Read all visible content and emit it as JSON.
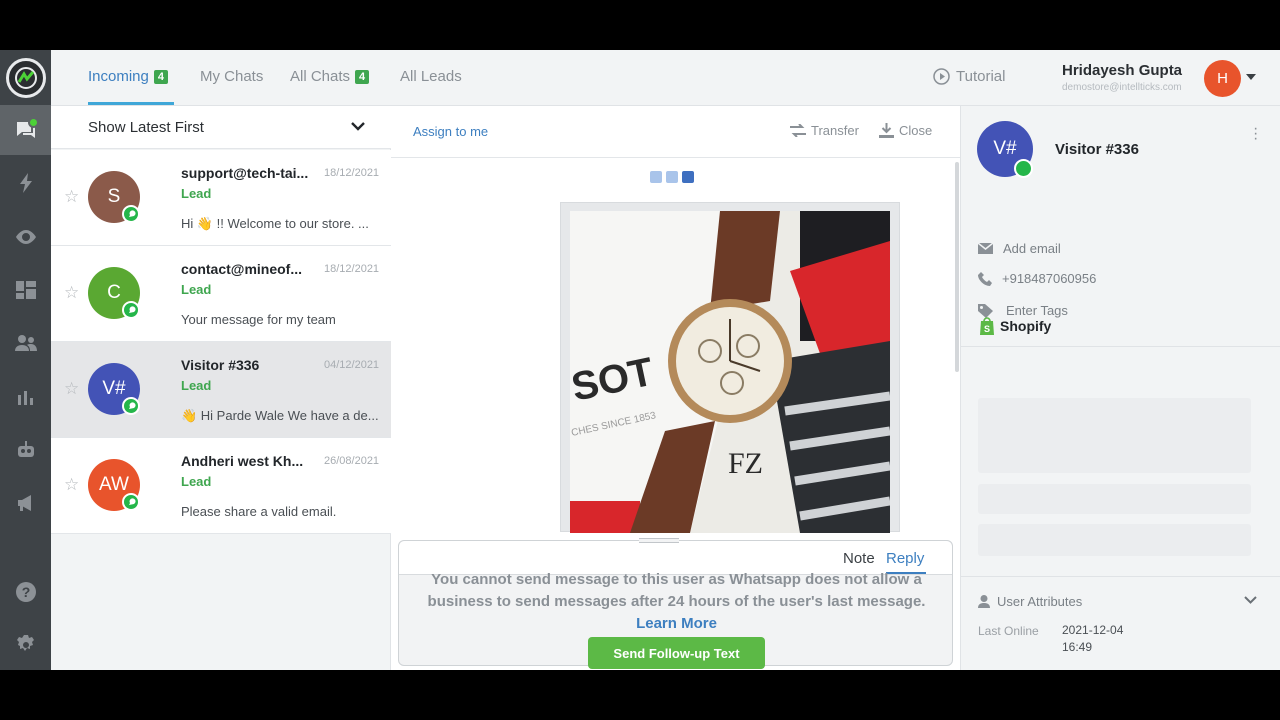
{
  "header": {
    "tabs": [
      {
        "label": "Incoming",
        "badge": "4"
      },
      {
        "label": "My Chats",
        "badge": ""
      },
      {
        "label": "All Chats",
        "badge": "4"
      },
      {
        "label": "All Leads",
        "badge": ""
      }
    ],
    "tutorial_label": "Tutorial",
    "user": {
      "name": "Hridayesh Gupta",
      "email": "demostore@intellticks.com",
      "initial": "H"
    }
  },
  "list": {
    "sort_label": "Show Latest First",
    "conversations": [
      {
        "initials": "S",
        "title": "support@tech-tai...",
        "date": "18/12/2021",
        "tag": "Lead",
        "preview": "Hi 👋 !! Welcome to our store. ...",
        "color": "#8b5a4a"
      },
      {
        "initials": "C",
        "title": "contact@mineof...",
        "date": "18/12/2021",
        "tag": "Lead",
        "preview": "Your message for my team",
        "color": "#5aa832"
      },
      {
        "initials": "V#",
        "title": "Visitor #336",
        "date": "04/12/2021",
        "tag": "Lead",
        "preview": "👋 Hi Parde Wale We have a de...",
        "color": "#4353b6"
      },
      {
        "initials": "AW",
        "title": "Andheri west  Kh...",
        "date": "26/08/2021",
        "tag": "Lead",
        "preview": "Please share a valid email.",
        "color": "#e8542c"
      }
    ]
  },
  "chat": {
    "assign_label": "Assign to me",
    "transfer_label": "Transfer",
    "close_label": "Close",
    "composer": {
      "note_label": "Note",
      "reply_label": "Reply",
      "warning_text": "You cannot send message to this user as Whatsapp does not allow a business to send messages after 24 hours of the user's last message.",
      "learn_more_label": "Learn More",
      "followup_label": "Send Follow-up Text"
    }
  },
  "visitor": {
    "initials": "V#",
    "name": "Visitor #336",
    "email_placeholder": "Add email",
    "phone": "+918487060956",
    "tags_placeholder": "Enter Tags",
    "shopify_label": "Shopify",
    "attributes_label": "User Attributes",
    "last_online_label": "Last Online",
    "last_online_value": "2021-12-04 16:49"
  },
  "icons": [
    "logo-icon",
    "chat-icon",
    "bolt-icon",
    "eye-icon",
    "dashboard-icon",
    "users-icon",
    "bar-chart-icon",
    "bot-icon",
    "megaphone-icon",
    "help-icon",
    "gear-icon"
  ]
}
